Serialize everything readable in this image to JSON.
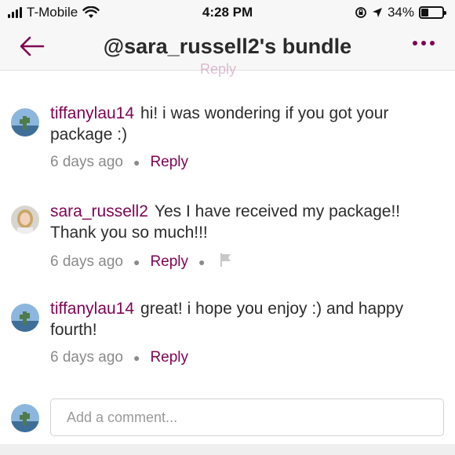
{
  "status_bar": {
    "carrier": "T-Mobile",
    "time": "4:28 PM",
    "battery": "34%",
    "battery_level": 0.34,
    "icons": [
      "signal-icon",
      "wifi-icon",
      "rotation-lock-icon",
      "location-arrow-icon",
      "battery-icon"
    ]
  },
  "header": {
    "title": "@sara_russell2's bundle",
    "back_icon": "back-arrow-icon",
    "more_icon": "more-dots-icon"
  },
  "comments": [
    {
      "username": "tiffanylau14",
      "text": "hi! i was wondering if you got your package :)",
      "time": "6 days ago",
      "reply_label": "Reply",
      "has_flag": false
    },
    {
      "username": "sara_russell2",
      "text": "Yes I  have received my package!!  Thank you so much!!!",
      "time": "6 days ago",
      "reply_label": "Reply",
      "has_flag": true
    },
    {
      "username": "tiffanylau14",
      "text": "great! i hope you enjoy :) and happy fourth!",
      "time": "6 days ago",
      "reply_label": "Reply",
      "has_flag": false
    }
  ],
  "composer": {
    "placeholder": "Add a comment...",
    "value": ""
  },
  "colors": {
    "accent": "#7f0353",
    "meta_text": "#8a8a8a",
    "header_bg": "#f7f7f7"
  }
}
